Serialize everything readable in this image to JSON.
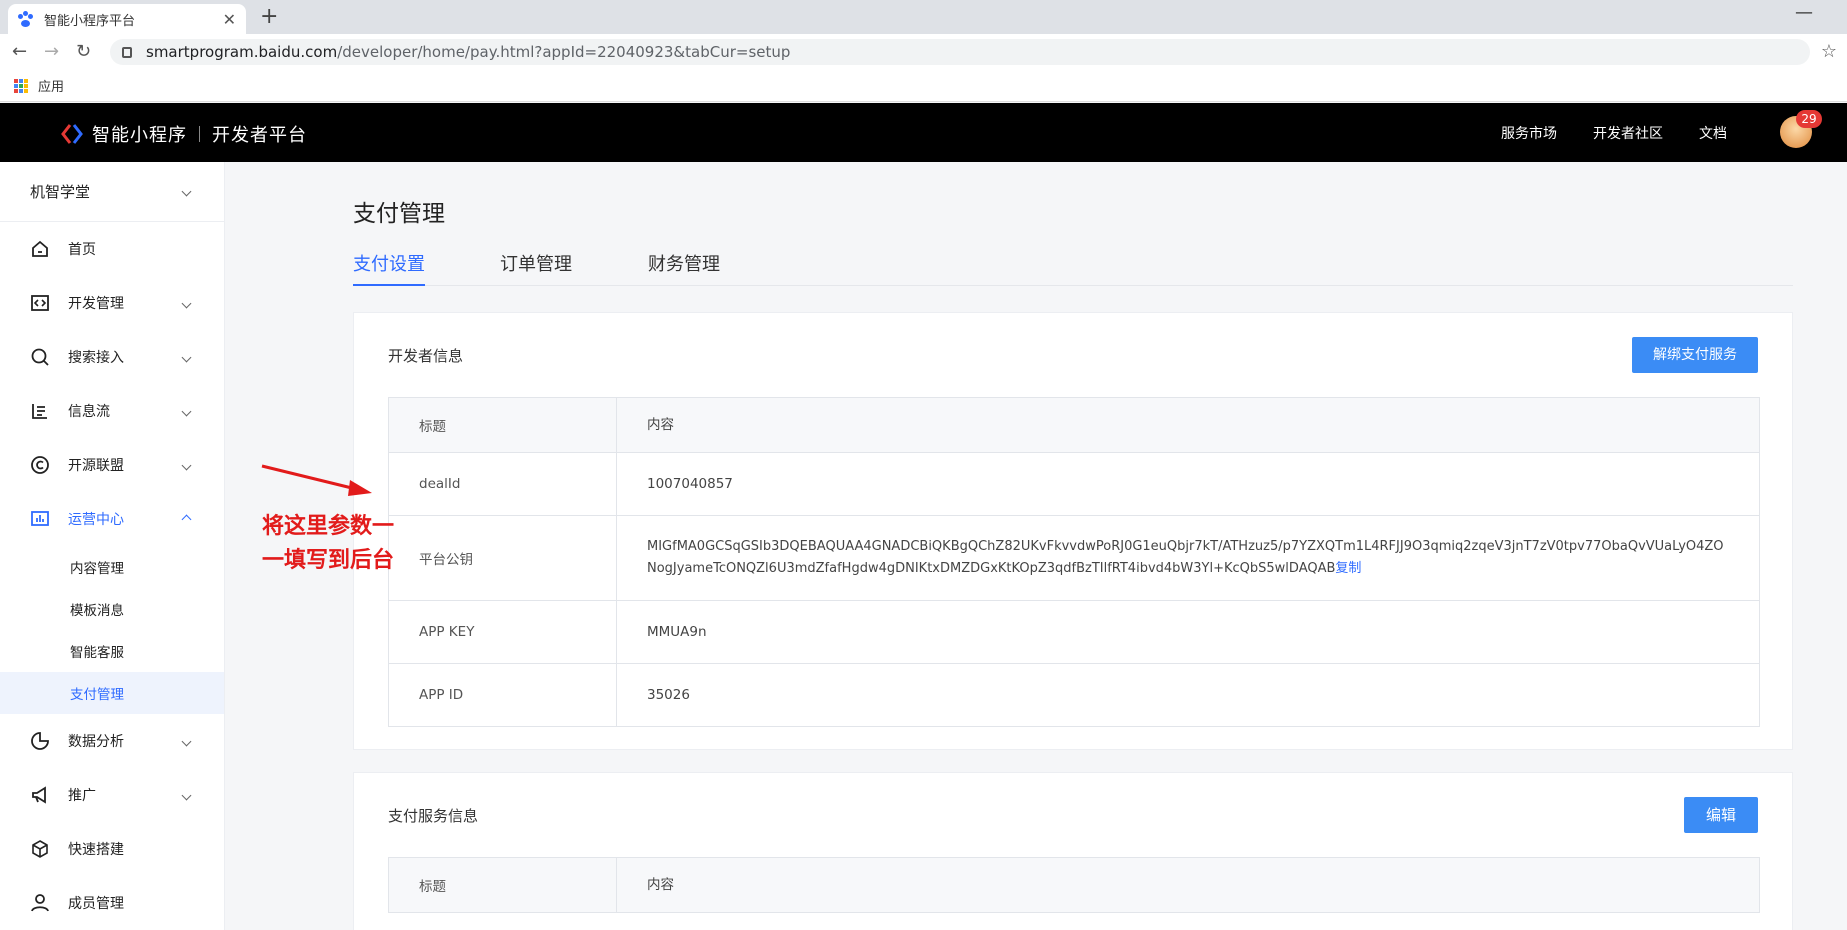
{
  "browser": {
    "tab_title": "智能小程序平台",
    "tab_close": "✕",
    "new_tab": "+",
    "minimize": "—",
    "url_host": "smartprogram.baidu.com",
    "url_path": "/developer/home/pay.html?appId=22040923&tabCur=setup",
    "bookmark_apps": "应用"
  },
  "header": {
    "brand": "智能小程序",
    "platform": "开发者平台",
    "nav": [
      "服务市场",
      "开发者社区",
      "文档"
    ],
    "badge_count": "29"
  },
  "sidebar": {
    "project": "机智学堂",
    "items": [
      {
        "label": "首页",
        "icon": "home-icon"
      },
      {
        "label": "开发管理",
        "icon": "code-icon"
      },
      {
        "label": "搜索接入",
        "icon": "search-icon"
      },
      {
        "label": "信息流",
        "icon": "feed-icon"
      },
      {
        "label": "开源联盟",
        "icon": "copyright-icon"
      },
      {
        "label": "运营中心",
        "icon": "chart-icon"
      },
      {
        "label": "数据分析",
        "icon": "pie-icon"
      },
      {
        "label": "推广",
        "icon": "megaphone-icon"
      },
      {
        "label": "快速搭建",
        "icon": "cube-icon"
      },
      {
        "label": "成员管理",
        "icon": "user-icon"
      }
    ],
    "sub_items": [
      "内容管理",
      "模板消息",
      "智能客服",
      "支付管理"
    ]
  },
  "main": {
    "title": "支付管理",
    "tabs": [
      "支付设置",
      "订单管理",
      "财务管理"
    ],
    "dev_info": {
      "title": "开发者信息",
      "button": "解绑支付服务",
      "head": [
        "标题",
        "内容"
      ],
      "rows": [
        {
          "label": "dealId",
          "value": "1007040857"
        },
        {
          "label": "平台公钥",
          "value": "MIGfMA0GCSqGSIb3DQEBAQUAA4GNADCBiQKBgQChZ82UKvFkvvdwPoRJ0G1euQbjr7kT/ATHzuz5/p7YZXQTm1L4RFJJ9O3qmiq2zqeV3jnT7zV0tpv77ObaQvVUaLyO4ZONogJyameTcONQZl6U3mdZfafHgdw4gDNIKtxDMZDGxKtKOpZ3qdfBzTIlfRT4ibvd4bW3Yl+KcQbS5wlDAQAB",
          "copy": "复制"
        },
        {
          "label": "APP KEY",
          "value": "MMUA9n"
        },
        {
          "label": "APP ID",
          "value": "35026"
        }
      ]
    },
    "pay_info": {
      "title": "支付服务信息",
      "button": "编辑",
      "head": [
        "标题",
        "内容"
      ]
    }
  },
  "annotation": {
    "line1": "将这里参数一",
    "line2": "一填写到后台",
    "color": "#e21b1b"
  }
}
